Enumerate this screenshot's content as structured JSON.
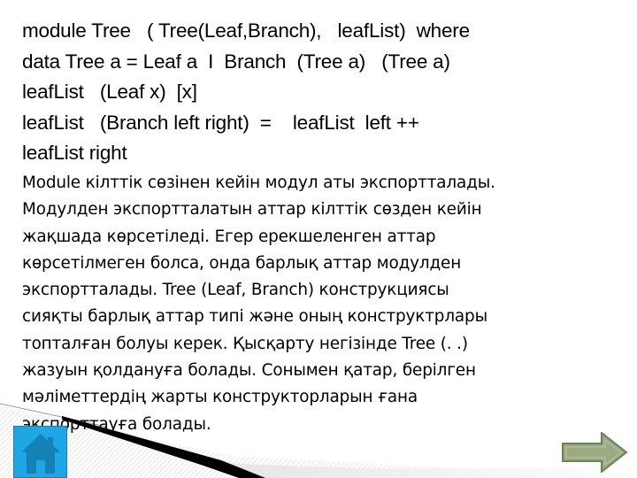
{
  "slide": {
    "code_lines": [
      "module Tree   ( Tree(Leaf,Branch),   leafList)  where",
      "data Tree a = Leaf a  I  Branch  (Tree a)   (Tree a)",
      "leafList   (Leaf x)  [x]",
      "leafList   (Branch left right)  =    leafList  left ++",
      "leafList right"
    ],
    "paragraph_lines": [
      "Module кілттік сөзінен кейін модул аты экспортталады.",
      "Модулден экспортталатын аттар кілттік сөзден кейін",
      "жақшада көрсетіледі. Егер ерекшеленген аттар",
      "көрсетілмеген болса, онда барлық аттар модулден",
      "экспортталады. Tree (Leaf, Branch) конструкциясы",
      "сияқты барлық аттар типі және оның конструктрлары",
      "топталған болуы керек. Қысқарту негізінде Tree (. .)",
      "жазуын қолдануға болады. Сонымен қатар, берілген",
      "мәліметтердің жарты конструкторларын ғана",
      "экспорттауға болады."
    ]
  },
  "navigation": {
    "home_icon": "home-icon",
    "next_icon": "arrow-right-icon"
  },
  "colors": {
    "home_button": "#1ea7e4",
    "home_glyph": "#1582b5",
    "next_arrow_fill": "#9aab82",
    "next_arrow_border": "#6f7f5c"
  }
}
